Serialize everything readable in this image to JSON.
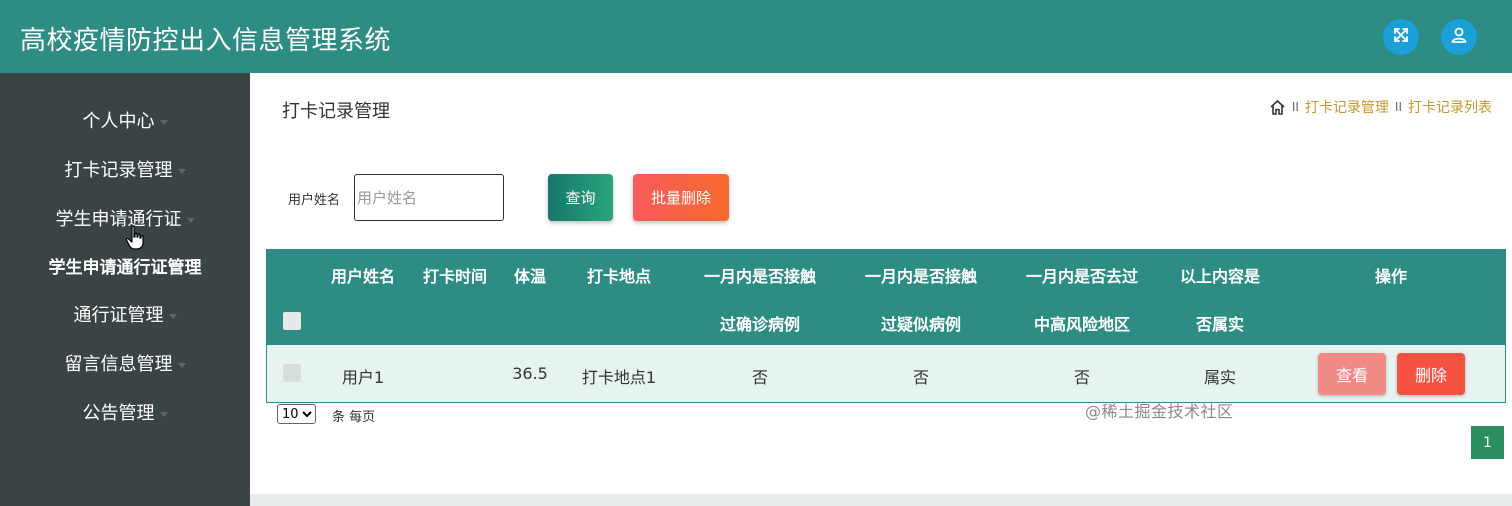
{
  "header": {
    "title": "高校疫情防控出入信息管理系统",
    "fullscreen_icon": "fullscreen-icon",
    "user_icon": "user-icon",
    "accent": "#2d8c83",
    "icon_button_color": "#1a9fd6"
  },
  "sidebar": {
    "items": [
      {
        "label": "个人中心"
      },
      {
        "label": "打卡记录管理"
      },
      {
        "label": "学生申请通行证"
      },
      {
        "label": "学生申请通行证管理"
      },
      {
        "label": "通行证管理"
      },
      {
        "label": "留言信息管理"
      },
      {
        "label": "公告管理"
      }
    ]
  },
  "main": {
    "page_title": "打卡记录管理",
    "breadcrumb": {
      "home_icon": "home-icon",
      "separator": "II",
      "items": [
        "打卡记录管理",
        "打卡记录列表"
      ]
    },
    "search": {
      "label": "用户姓名",
      "placeholder": "用户姓名",
      "value": "",
      "query_button": "查询",
      "batch_delete_button": "批量删除"
    },
    "table": {
      "columns": [
        {
          "l1": "用户姓名",
          "l2": ""
        },
        {
          "l1": "打卡时间",
          "l2": ""
        },
        {
          "l1": "体温",
          "l2": ""
        },
        {
          "l1": "打卡地点",
          "l2": ""
        },
        {
          "l1": "一月内是否接触",
          "l2": "过确诊病例"
        },
        {
          "l1": "一月内是否接触",
          "l2": "过疑似病例"
        },
        {
          "l1": "一月内是否去过",
          "l2": "中高风险地区"
        },
        {
          "l1": "以上内容是",
          "l2": "否属实"
        },
        {
          "l1": "操作",
          "l2": ""
        }
      ],
      "rows": [
        {
          "cells": [
            "用户1",
            "",
            "36.5",
            "打卡地点1",
            "否",
            "否",
            "否",
            "属实"
          ],
          "view_button": "查看",
          "delete_button": "删除"
        }
      ]
    },
    "pagination": {
      "page_size": "10",
      "page_size_suffix": "条 每页",
      "current_page": "1"
    }
  },
  "watermark": "@稀土掘金技术社区"
}
